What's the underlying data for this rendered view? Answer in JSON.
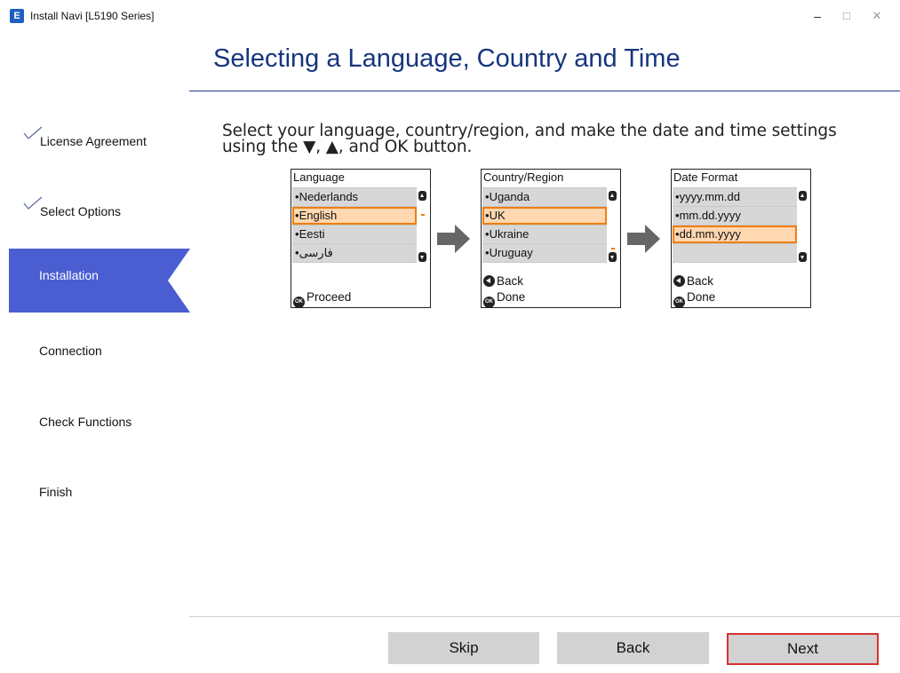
{
  "window": {
    "title": "Install Navi [L5190 Series]",
    "icon_letter": "E",
    "controls": {
      "minimize": "–",
      "maximize": "□",
      "close": "✕"
    }
  },
  "header": {
    "title": "Selecting a Language, Country and Time"
  },
  "sidebar": {
    "steps": [
      {
        "label": "License Agreement",
        "state": "done"
      },
      {
        "label": "Select Options",
        "state": "done"
      },
      {
        "label": "Installation",
        "state": "active"
      },
      {
        "label": "Connection",
        "state": "pending"
      },
      {
        "label": "Check Functions",
        "state": "pending"
      },
      {
        "label": "Finish",
        "state": "pending"
      }
    ]
  },
  "main": {
    "instruction_line1": "Select your language, country/region, and make the date and time settings",
    "instruction_line2": "using the ▼, ▲, and OK button.",
    "panels": [
      {
        "header": "Language",
        "items": [
          "Nederlands",
          "English",
          "Eesti",
          "فارسی"
        ],
        "selected_index": 1,
        "footer": [
          {
            "icon": "ok-button-icon",
            "badge": "OK",
            "label": "Proceed"
          }
        ]
      },
      {
        "header": "Country/Region",
        "items": [
          "Uganda",
          "UK",
          "Ukraine",
          "Uruguay"
        ],
        "selected_index": 1,
        "footer": [
          {
            "icon": "back-button-icon",
            "label": "Back"
          },
          {
            "icon": "ok-button-icon",
            "badge": "OK",
            "label": "Done"
          }
        ]
      },
      {
        "header": "Date Format",
        "items": [
          "yyyy.mm.dd",
          "mm.dd.yyyy",
          "dd.mm.yyyy"
        ],
        "selected_index": 2,
        "footer": [
          {
            "icon": "back-button-icon",
            "label": "Back"
          },
          {
            "icon": "ok-button-icon",
            "badge": "OK",
            "label": "Done"
          }
        ]
      }
    ],
    "accent_color": "#f07d10",
    "arrow_icon": "right-arrow-icon"
  },
  "footer": {
    "skip_label": "Skip",
    "back_label": "Back",
    "next_label": "Next"
  },
  "colors": {
    "title": "#17357e",
    "active_step": "#4a5ed1",
    "button": "#d2d2d2",
    "next_highlight": "#d93030"
  }
}
